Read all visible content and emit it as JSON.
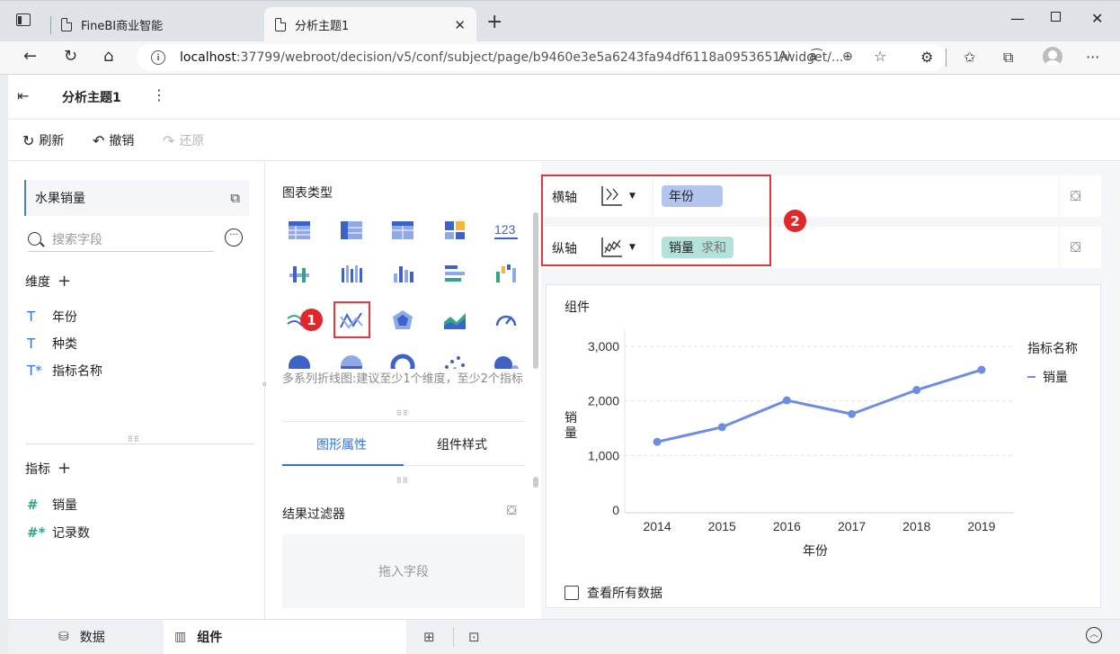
{
  "browser": {
    "tabs": [
      {
        "label": "FineBI商业智能"
      },
      {
        "label": "分析主题1"
      }
    ],
    "url_host": "localhost",
    "url_rest": ":37799/webroot/decision/v5/conf/subject/page/b9460e3e5a6243fa94df6118a0953651/widget/...",
    "reader_icon": "A⁾",
    "translate_icon": "a͡",
    "new_tab": "+"
  },
  "app": {
    "title": "分析主题1",
    "toolbar": {
      "refresh": "刷新",
      "undo": "撤销",
      "redo": "还原"
    }
  },
  "left_panel": {
    "dataset": "水果销量",
    "search_placeholder": "搜索字段",
    "dimension_header": "维度",
    "dimensions": [
      {
        "type": "T",
        "name": "年份"
      },
      {
        "type": "T",
        "name": "种类"
      },
      {
        "type": "T*",
        "name": "指标名称"
      }
    ],
    "measure_header": "指标",
    "measures": [
      {
        "type": "#",
        "name": "销量"
      },
      {
        "type": "#*",
        "name": "记录数"
      }
    ]
  },
  "chart_panel": {
    "header": "图表类型",
    "hint": "多系列折线图:建议至少1个维度，至少2个指标",
    "badge1": "1",
    "tabs": [
      "图形属性",
      "组件样式"
    ],
    "filter_header": "结果过滤器",
    "filter_placeholder": "拖入字段"
  },
  "axes": {
    "x_label": "横轴",
    "y_label": "纵轴",
    "x_field": "年份",
    "y_field": "销量",
    "y_agg": "求和",
    "badge2": "2"
  },
  "widget": {
    "title": "组件",
    "legend_title": "指标名称",
    "show_all": "查看所有数据"
  },
  "chart_data": {
    "type": "line",
    "x": [
      "2014",
      "2015",
      "2016",
      "2017",
      "2018",
      "2019"
    ],
    "series": [
      {
        "name": "销量",
        "values": [
          1250,
          1520,
          2010,
          1760,
          2200,
          2570
        ]
      }
    ],
    "xlabel": "年份",
    "ylabel": "销量",
    "yticks": [
      "0",
      "1,000",
      "2,000",
      "3,000"
    ],
    "ylim": [
      0,
      3000
    ],
    "color": "#6d8ee0",
    "grid": true,
    "legend_position": "top-right"
  },
  "bottom": {
    "tab_data": "数据",
    "tab_widget": "组件"
  }
}
